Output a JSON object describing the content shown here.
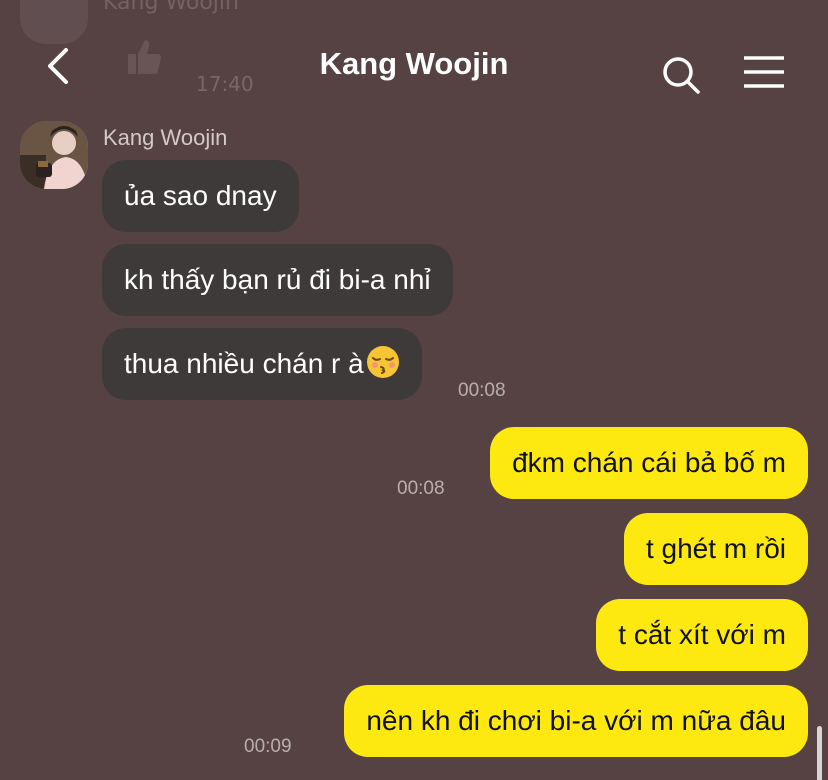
{
  "header": {
    "title": "Kang Woojin",
    "back_icon": "chevron-left-icon",
    "search_icon": "search-icon",
    "menu_icon": "hamburger-menu-icon"
  },
  "previous": {
    "sender": "Kang Woojin",
    "like_icon": "thumbs-up-icon",
    "time": "17:40"
  },
  "incoming": {
    "sender": "Kang Woojin",
    "messages": [
      {
        "text": "ủa sao dnay"
      },
      {
        "text": "kh thấy bạn rủ đi bi-a nhỉ"
      },
      {
        "text": "thua nhiều chán r à",
        "emoji": "kissing-face-closed-eyes-emoji"
      }
    ],
    "time": "00:08"
  },
  "outgoing": {
    "messages": [
      {
        "text": "đkm chán cái bả bố m",
        "time": "00:08"
      },
      {
        "text": "t ghét m rồi"
      },
      {
        "text": "t cắt xít với m"
      },
      {
        "text": "nên kh đi chơi bi-a với m nữa đâu",
        "time": "00:09"
      }
    ]
  },
  "colors": {
    "background": "#564143",
    "incoming_bubble": "#3f3a3a",
    "outgoing_bubble": "#fde90f"
  }
}
